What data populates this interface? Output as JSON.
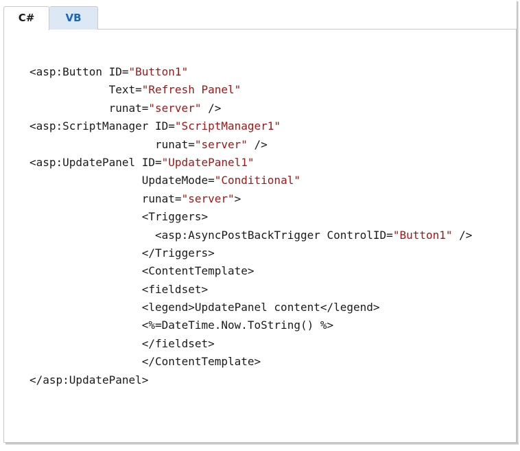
{
  "tabs": [
    {
      "label": "C#",
      "selected": true
    },
    {
      "label": "VB",
      "selected": false
    }
  ],
  "colors": {
    "string": "#a31515",
    "plain": "#1a1a1a",
    "tab_inactive_bg": "#dde8f5",
    "tab_inactive_text": "#1c66b8",
    "border": "#c8c8c8"
  },
  "code_lines": [
    {
      "indent": "",
      "tokens": [
        {
          "t": "<asp:Button ID="
        },
        {
          "s": "\"Button1\""
        }
      ]
    },
    {
      "indent": "            ",
      "tokens": [
        {
          "t": "Text="
        },
        {
          "s": "\"Refresh Panel\""
        }
      ]
    },
    {
      "indent": "            ",
      "tokens": [
        {
          "t": "runat="
        },
        {
          "s": "\"server\""
        },
        {
          "t": " />"
        }
      ]
    },
    {
      "indent": "",
      "tokens": [
        {
          "t": "<asp:ScriptManager ID="
        },
        {
          "s": "\"ScriptManager1\""
        }
      ]
    },
    {
      "indent": "                   ",
      "tokens": [
        {
          "t": "runat="
        },
        {
          "s": "\"server\""
        },
        {
          "t": " />"
        }
      ]
    },
    {
      "indent": "",
      "tokens": [
        {
          "t": "<asp:UpdatePanel ID="
        },
        {
          "s": "\"UpdatePanel1\""
        }
      ]
    },
    {
      "indent": "                 ",
      "tokens": [
        {
          "t": "UpdateMode="
        },
        {
          "s": "\"Conditional\""
        }
      ]
    },
    {
      "indent": "                 ",
      "tokens": [
        {
          "t": "runat="
        },
        {
          "s": "\"server\""
        },
        {
          "t": ">"
        }
      ]
    },
    {
      "indent": "                 ",
      "tokens": [
        {
          "t": "<Triggers>"
        }
      ]
    },
    {
      "indent": "                   ",
      "tokens": [
        {
          "t": "<asp:AsyncPostBackTrigger ControlID="
        },
        {
          "s": "\"Button1\""
        },
        {
          "t": " />"
        }
      ]
    },
    {
      "indent": "                 ",
      "tokens": [
        {
          "t": "</Triggers>"
        }
      ]
    },
    {
      "indent": "                 ",
      "tokens": [
        {
          "t": "<ContentTemplate>"
        }
      ]
    },
    {
      "indent": "                 ",
      "tokens": [
        {
          "t": "<fieldset>"
        }
      ]
    },
    {
      "indent": "                 ",
      "tokens": [
        {
          "t": "<legend>UpdatePanel content</legend>"
        }
      ]
    },
    {
      "indent": "                 ",
      "tokens": [
        {
          "t": "<%=DateTime.Now.ToString() %>"
        }
      ]
    },
    {
      "indent": "                 ",
      "tokens": [
        {
          "t": "</fieldset>"
        }
      ]
    },
    {
      "indent": "                 ",
      "tokens": [
        {
          "t": "</ContentTemplate>"
        }
      ]
    },
    {
      "indent": "",
      "tokens": [
        {
          "t": "</asp:UpdatePanel>"
        }
      ]
    }
  ]
}
